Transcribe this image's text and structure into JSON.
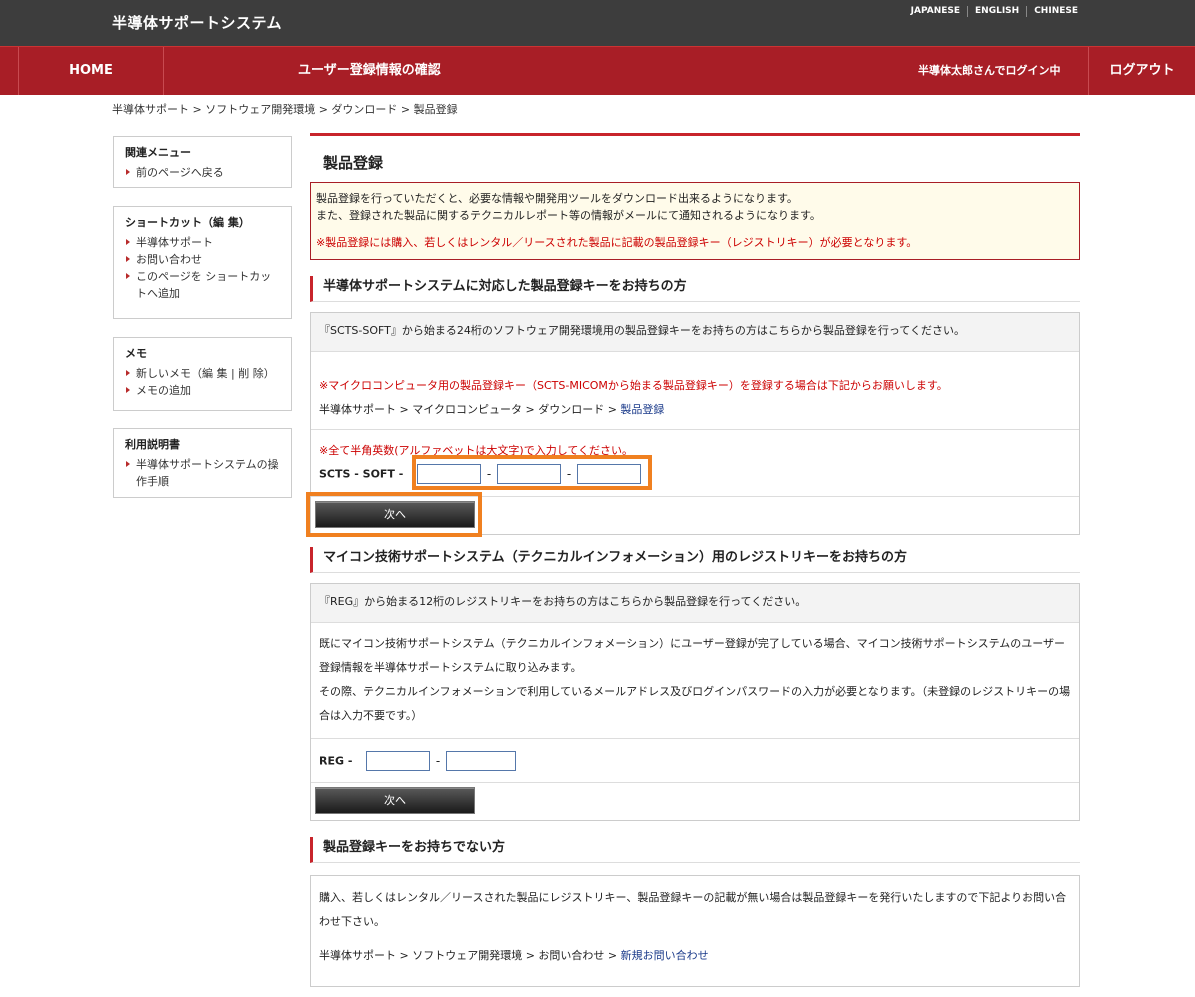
{
  "header": {
    "site_title": "半導体サポートシステム",
    "languages": [
      "JAPANESE",
      "ENGLISH",
      "CHINESE"
    ]
  },
  "nav": {
    "home": "HOME",
    "confirm": "ユーザー登録情報の確認",
    "user_status": "半導体太郎さんでログイン中",
    "logout": "ログアウト"
  },
  "breadcrumb": "半導体サポート > ソフトウェア開発環境 > ダウンロード > 製品登録",
  "sidebar": {
    "related": {
      "title": "関連メニュー",
      "items": [
        "前のページへ戻る"
      ]
    },
    "shortcut": {
      "title": "ショートカット（編 集）",
      "items": [
        "半導体サポート",
        "お問い合わせ",
        "このページを ショートカットへ追加"
      ]
    },
    "memo": {
      "title": "メモ",
      "items": [
        "新しいメモ（編 集 | 削 除）",
        "メモの追加"
      ]
    },
    "manual": {
      "title": "利用説明書",
      "items": [
        "半導体サポートシステムの操作手順"
      ]
    }
  },
  "main": {
    "title": "製品登録",
    "notice": {
      "line1": "製品登録を行っていただくと、必要な情報や開発用ツールをダウンロード出来るようになります。",
      "line2": "また、登録された製品に関するテクニカルレポート等の情報がメールにて通知されるようになります。",
      "red": "※製品登録には購入、若しくはレンタル／リースされた製品に記載の製品登録キー（レジストリキー）が必要となります。"
    },
    "section1": {
      "heading": "半導体サポートシステムに対応した製品登録キーをお持ちの方",
      "intro": "『SCTS-SOFT』から始まる24桁のソフトウェア開発環境用の製品登録キーをお持ちの方はこちらから製品登録を行ってください。",
      "micom_note": "※マイクロコンピュータ用の製品登録キー（SCTS-MICOMから始まる製品登録キー）を登録する場合は下記からお願いします。",
      "micom_path": "半導体サポート > マイクロコンピュータ > ダウンロード > ",
      "micom_link": "製品登録",
      "input_note": "※全て半角英数(アルファベットは大文字)で入力してください。",
      "key_label": "SCTS - SOFT -",
      "next": "次へ"
    },
    "section2": {
      "heading": "マイコン技術サポートシステム（テクニカルインフォメーション）用のレジストリキーをお持ちの方",
      "intro": "『REG』から始まる12桁のレジストリキーをお持ちの方はこちらから製品登録を行ってください。",
      "para1": "既にマイコン技術サポートシステム（テクニカルインフォメーション）にユーザー登録が完了している場合、マイコン技術サポートシステムのユーザー登録情報を半導体サポートシステムに取り込みます。",
      "para2": "その際、テクニカルインフォメーションで利用しているメールアドレス及びログインパスワードの入力が必要となります。（未登録のレジストリキーの場合は入力不要です。）",
      "key_label": "REG -",
      "next": "次へ"
    },
    "section3": {
      "heading": "製品登録キーをお持ちでない方",
      "para": "購入、若しくはレンタル／リースされた製品にレジストリキー、製品登録キーの記載が無い場合は製品登録キーを発行いたしますので下記よりお問い合わせ下さい。",
      "path": "半導体サポート > ソフトウェア開発環境 > お問い合わせ > ",
      "link": "新規お問い合わせ"
    }
  },
  "colors": {
    "brand_red": "#a81e26",
    "highlight": "#f08020",
    "link": "#1a3a8a"
  }
}
